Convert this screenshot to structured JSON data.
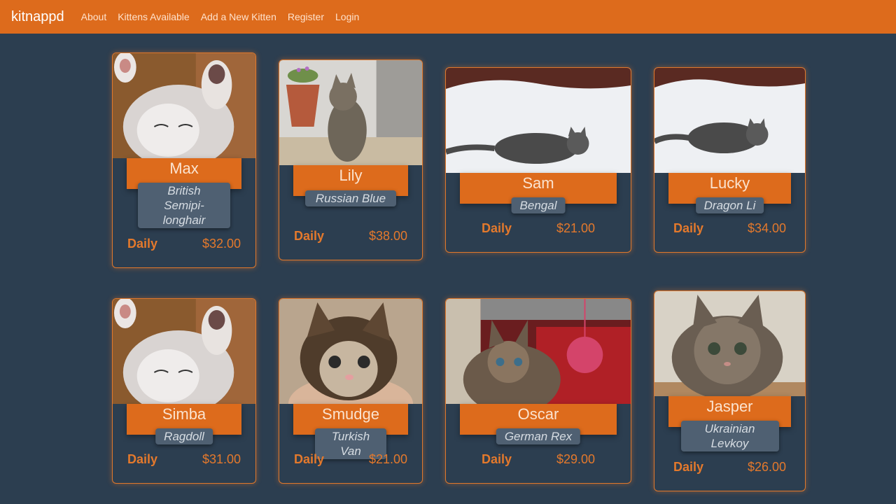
{
  "navbar": {
    "brand": "kitnappd",
    "links": [
      "About",
      "Kittens Available",
      "Add a New Kitten",
      "Register",
      "Login"
    ]
  },
  "colors": {
    "nav_bg": "#dd6b1c",
    "page_bg": "#2c3e50",
    "accent": "#e4792c",
    "breed_badge": "#4f6072"
  },
  "kittens": [
    {
      "name": "Max",
      "breed": "British Semipi-longhair",
      "rate_label": "Daily",
      "price": "$32.00"
    },
    {
      "name": "Lily",
      "breed": "Russian Blue",
      "rate_label": "Daily",
      "price": "$38.00"
    },
    {
      "name": "Sam",
      "breed": "Bengal",
      "rate_label": "Daily",
      "price": "$21.00"
    },
    {
      "name": "Lucky",
      "breed": "Dragon Li",
      "rate_label": "Daily",
      "price": "$34.00"
    },
    {
      "name": "Simba",
      "breed": "Ragdoll",
      "rate_label": "Daily",
      "price": "$31.00"
    },
    {
      "name": "Smudge",
      "breed": "Turkish Van",
      "rate_label": "Daily",
      "price": "$21.00"
    },
    {
      "name": "Oscar",
      "breed": "German Rex",
      "rate_label": "Daily",
      "price": "$29.00"
    },
    {
      "name": "Jasper",
      "breed": "Ukrainian Levkoy",
      "rate_label": "Daily",
      "price": "$26.00"
    }
  ]
}
